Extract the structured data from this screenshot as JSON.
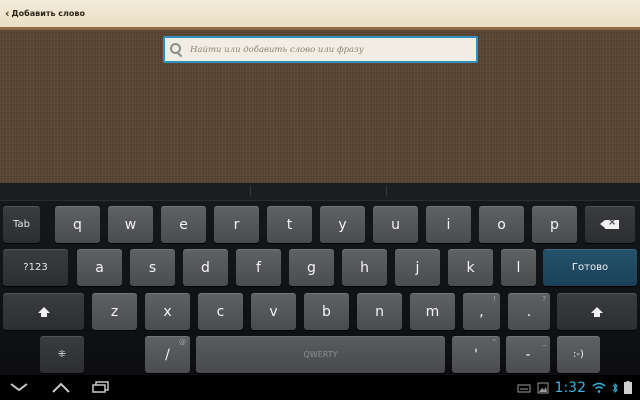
{
  "topbar": {
    "title": "Добавить слово"
  },
  "search": {
    "placeholder": "Найти или добавить слово или фразу"
  },
  "keyboard": {
    "row1": [
      "q",
      "w",
      "e",
      "r",
      "t",
      "y",
      "u",
      "i",
      "o",
      "p"
    ],
    "row2": [
      "a",
      "s",
      "d",
      "f",
      "g",
      "h",
      "j",
      "k",
      "l"
    ],
    "row3": [
      "z",
      "x",
      "c",
      "v",
      "b",
      "n",
      "m",
      ",",
      "."
    ],
    "tab_label": "Tab",
    "symbols_label": "?123",
    "done_label": "Готово",
    "slash_label": "/",
    "space_label": "QWERTY",
    "apostrophe_label": "'",
    "dash_label": "-",
    "smiley_label": ":-)",
    "settings_label": "⁜",
    "hints": {
      "comma": "!",
      "period": "?",
      "slash": "@",
      "apostrophe": "\"",
      "dash": "_"
    }
  },
  "status": {
    "time": "1:32"
  },
  "colors": {
    "accent": "#33b5e5",
    "done_key": "#1b4158",
    "search_border": "#2f8fbd"
  }
}
